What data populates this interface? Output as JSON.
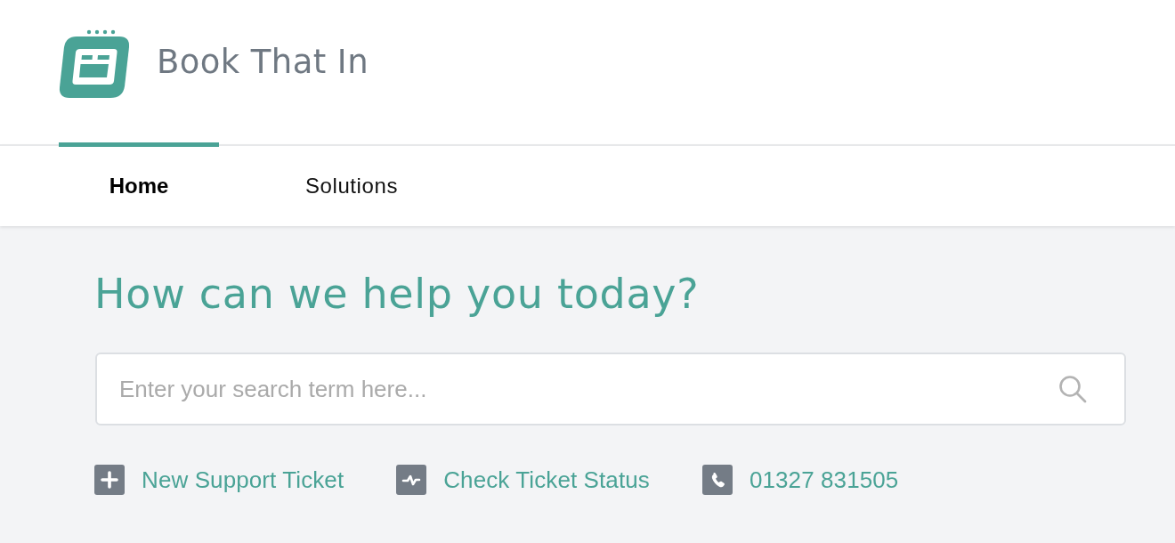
{
  "header": {
    "title": "Book That In"
  },
  "nav": {
    "tabs": [
      {
        "label": "Home",
        "selected": true
      },
      {
        "label": "Solutions",
        "selected": false
      }
    ]
  },
  "hero": {
    "heading": "How can we help you today?",
    "search": {
      "placeholder": "Enter your search term here..."
    }
  },
  "quick_links": [
    {
      "kind": "new-ticket",
      "label": "New Support Ticket"
    },
    {
      "kind": "status",
      "label": "Check Ticket Status"
    },
    {
      "kind": "phone",
      "label": "01327 831505"
    }
  ]
}
